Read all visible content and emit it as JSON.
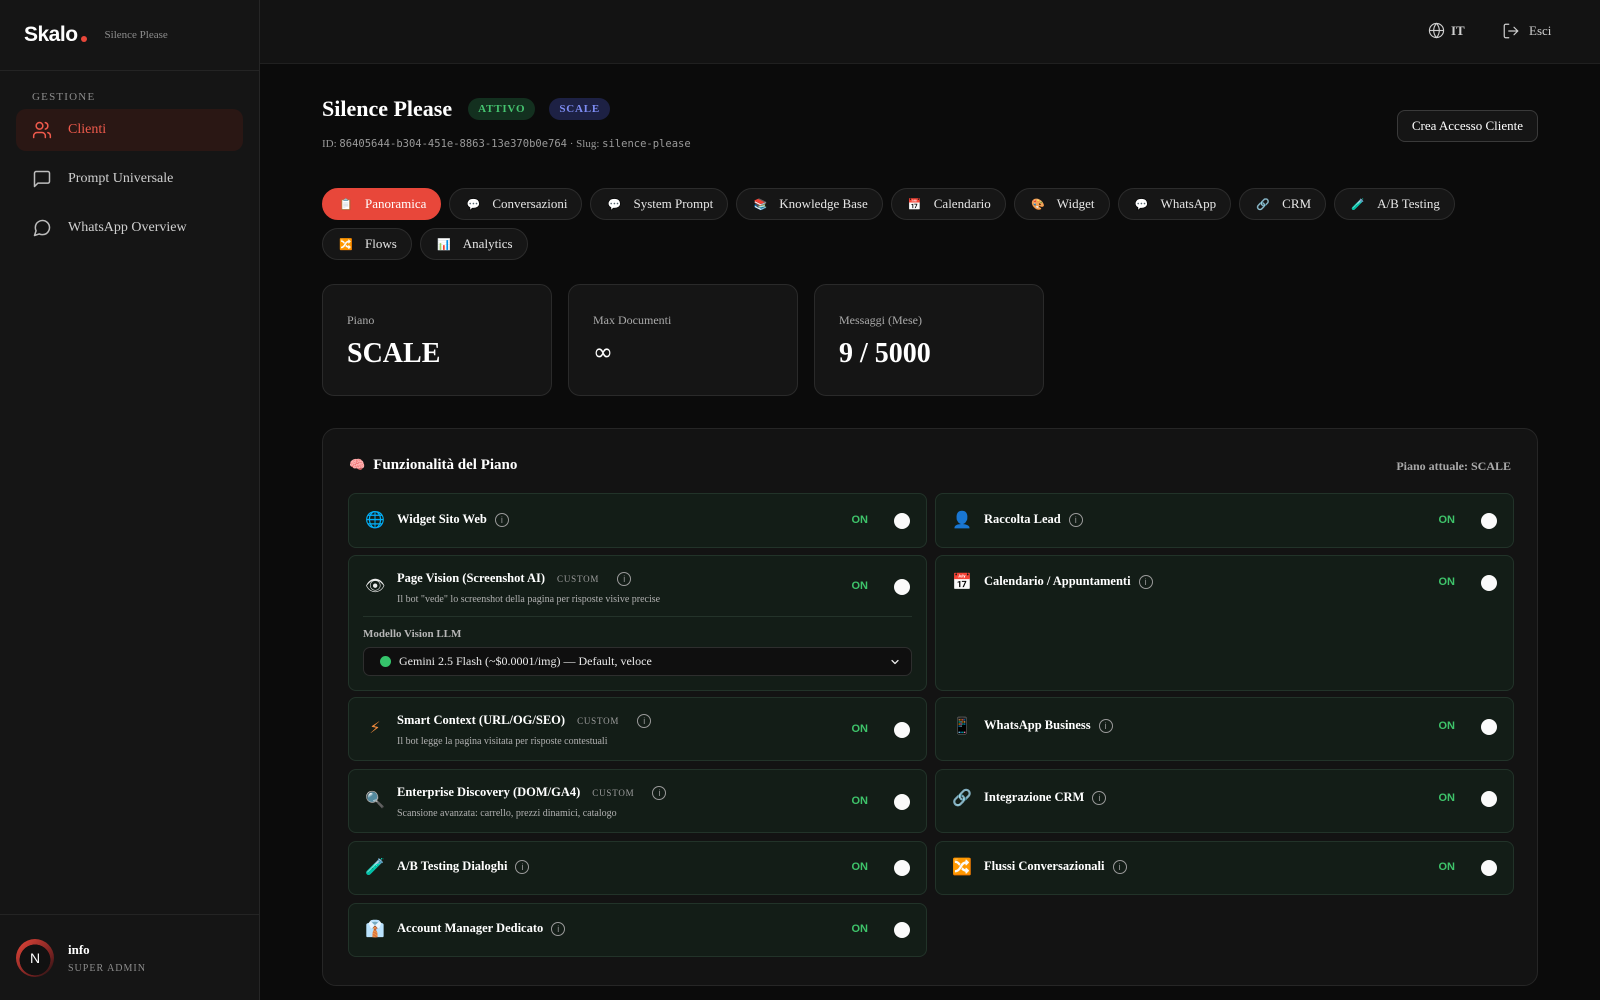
{
  "brand": {
    "logo": "Skalo",
    "subtitle": "Silence Please"
  },
  "sidebar": {
    "section": "GESTIONE",
    "items": [
      {
        "label": "Clienti",
        "icon": "users-icon",
        "active": true
      },
      {
        "label": "Prompt Universale",
        "icon": "message-square-icon",
        "active": false
      },
      {
        "label": "WhatsApp Overview",
        "icon": "message-circle-icon",
        "active": false
      }
    ],
    "user": {
      "initial": "N",
      "name": "info",
      "role": "SUPER ADMIN"
    }
  },
  "topbar": {
    "lang": "IT",
    "logout": "Esci"
  },
  "client": {
    "name": "Silence Please",
    "status_badge": "ATTIVO",
    "plan_badge": "SCALE",
    "id_label": "ID:",
    "id_value": "86405644-b304-451e-8863-13e370b0e764",
    "slug_label": "· Slug:",
    "slug_value": "silence-please",
    "create_access_button": "Crea Accesso Cliente"
  },
  "tabs": [
    {
      "label": "Panoramica",
      "icon": "📋",
      "active": true
    },
    {
      "label": "Conversazioni",
      "icon": "💬"
    },
    {
      "label": "System Prompt",
      "icon": "💬"
    },
    {
      "label": "Knowledge Base",
      "icon": "📚"
    },
    {
      "label": "Calendario",
      "icon": "📅"
    },
    {
      "label": "Widget",
      "icon": "🎨"
    },
    {
      "label": "WhatsApp",
      "icon": "💬"
    },
    {
      "label": "CRM",
      "icon": "🔗"
    },
    {
      "label": "A/B Testing",
      "icon": "🧪"
    },
    {
      "label": "Flows",
      "icon": "🔀"
    },
    {
      "label": "Analytics",
      "icon": "📊"
    }
  ],
  "stats": [
    {
      "label": "Piano",
      "value": "SCALE"
    },
    {
      "label": "Max Documenti",
      "value": "∞"
    },
    {
      "label": "Messaggi (Mese)",
      "value": "9 / 5000"
    }
  ],
  "features": {
    "title": "Funzionalità del Piano",
    "title_icon": "🧠",
    "current_plan": "Piano attuale: SCALE",
    "on_label": "ON",
    "custom_label": "CUSTOM",
    "vision_model_label": "Modello Vision LLM",
    "vision_model_value": "Gemini 2.5 Flash (~$0.0001/img) — Default, veloce",
    "items": {
      "widget": {
        "icon": "🌐",
        "name": "Widget Sito Web",
        "status": "ON",
        "enabled": true
      },
      "lead": {
        "icon": "👤",
        "name": "Raccolta Lead",
        "status": "ON",
        "enabled": true
      },
      "vision": {
        "icon": "👁",
        "name": "Page Vision (Screenshot AI)",
        "custom": "CUSTOM",
        "desc": "Il bot \"vede\" lo screenshot della pagina per risposte visive precise",
        "status": "ON",
        "enabled": true
      },
      "calendar": {
        "icon": "📅",
        "name": "Calendario / Appuntamenti",
        "status": "ON",
        "enabled": true
      },
      "smart": {
        "icon": "⚡",
        "name": "Smart Context (URL/OG/SEO)",
        "custom": "CUSTOM",
        "desc": "Il bot legge la pagina visitata per risposte contestuali",
        "status": "ON",
        "enabled": true
      },
      "whatsapp": {
        "icon": "📱",
        "name": "WhatsApp Business",
        "status": "ON",
        "enabled": true
      },
      "discovery": {
        "icon": "🔍",
        "name": "Enterprise Discovery (DOM/GA4)",
        "custom": "CUSTOM",
        "desc": "Scansione avanzata: carrello, prezzi dinamici, catalogo",
        "status": "ON",
        "enabled": true
      },
      "crm": {
        "icon": "🔗",
        "name": "Integrazione CRM",
        "status": "ON",
        "enabled": true
      },
      "ab": {
        "icon": "🧪",
        "name": "A/B Testing Dialoghi",
        "status": "ON",
        "enabled": true
      },
      "flows": {
        "icon": "🔀",
        "name": "Flussi Conversazionali",
        "status": "ON",
        "enabled": true
      },
      "manager": {
        "icon": "👔",
        "name": "Account Manager Dedicato",
        "status": "ON",
        "enabled": true
      }
    }
  },
  "colors": {
    "accent": "#e8473a",
    "on_green": "#3ec36a",
    "card_bg": "#131d17"
  }
}
